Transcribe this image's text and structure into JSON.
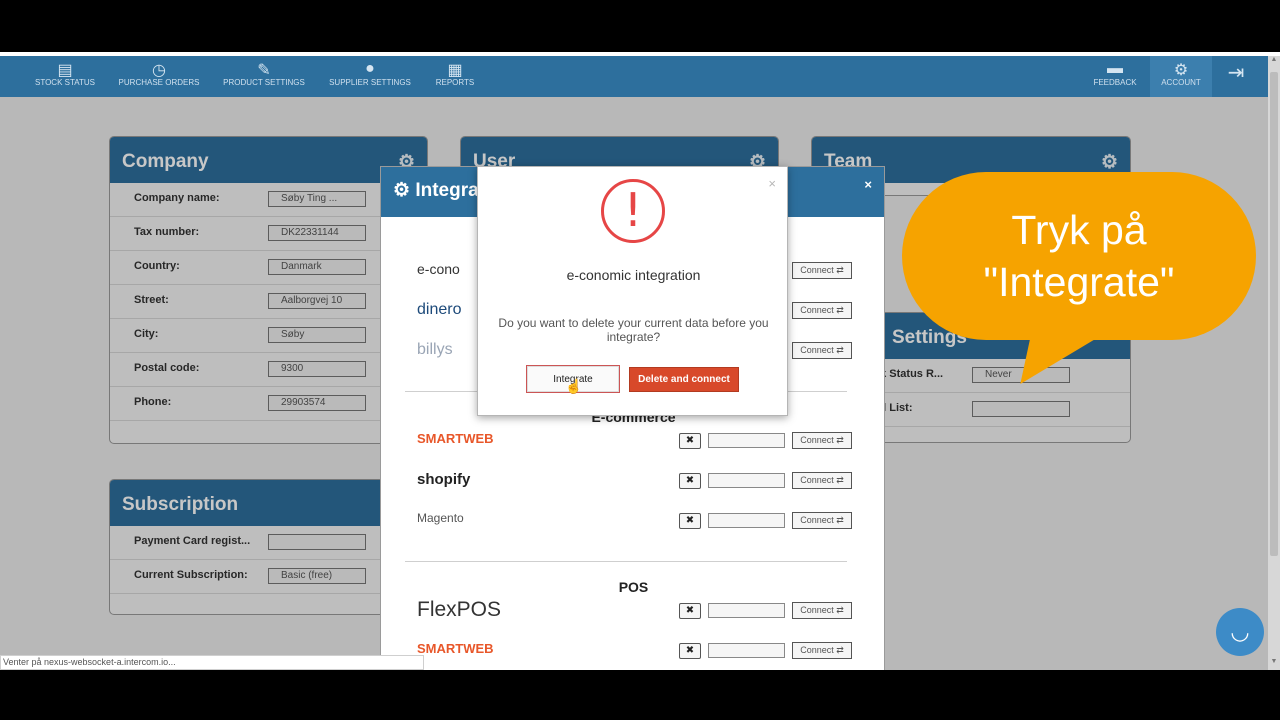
{
  "nav": {
    "items": [
      {
        "label": "STOCK STATUS",
        "icon": "list-icon"
      },
      {
        "label": "PURCHASE ORDERS",
        "icon": "clock-icon"
      },
      {
        "label": "PRODUCT SETTINGS",
        "icon": "pencil-icon"
      },
      {
        "label": "SUPPLIER SETTINGS",
        "icon": "user-icon"
      },
      {
        "label": "REPORTS",
        "icon": "clipboard-icon"
      }
    ],
    "right_items": [
      {
        "label": "FEEDBACK",
        "icon": "chat-icon"
      },
      {
        "label": "ACCOUNT",
        "icon": "gear-icon"
      },
      {
        "label": "",
        "icon": "logout-icon"
      }
    ]
  },
  "company": {
    "title": "Company",
    "rows": [
      {
        "label": "Company name:",
        "value": "Søby Ting ..."
      },
      {
        "label": "Tax number:",
        "value": "DK22331144"
      },
      {
        "label": "Country:",
        "value": "Danmark"
      },
      {
        "label": "Street:",
        "value": "Aalborgvej 10"
      },
      {
        "label": "City:",
        "value": "Søby"
      },
      {
        "label": "Postal code:",
        "value": "9300"
      },
      {
        "label": "Phone:",
        "value": "29903574"
      }
    ]
  },
  "user": {
    "title": "User"
  },
  "team": {
    "title": "Team"
  },
  "settings": {
    "title": "Settings",
    "rows": [
      {
        "label": "ck Status R...",
        "value": "Never"
      },
      {
        "label": "ail List:",
        "value": ""
      }
    ]
  },
  "subscription": {
    "title": "Subscription",
    "rows": [
      {
        "label": "Payment Card regist...",
        "value": ""
      },
      {
        "label": "Current Subscription:",
        "value": "Basic (free)"
      }
    ]
  },
  "integrations": {
    "title": "Integra",
    "close": "×",
    "accounting": [
      {
        "name": "e-conomic",
        "logo": "e-cono",
        "color": "#333333",
        "connect": "Connect ⇄"
      },
      {
        "name": "dinero",
        "logo": "dinero",
        "color": "#1d4a7a",
        "connect": "Connect ⇄"
      },
      {
        "name": "billys",
        "logo": "billys",
        "color": "#9aa5b5",
        "connect": "Connect ⇄"
      }
    ],
    "ecommerce_title": "E-commerce",
    "ecommerce": [
      {
        "name": "smartweb",
        "logo": "SMARTWEB",
        "color": "#e8572a",
        "connect": "Connect ⇄"
      },
      {
        "name": "shopify",
        "logo": "shopify",
        "color": "#222222",
        "connect": "Connect ⇄"
      },
      {
        "name": "magento",
        "logo": "Magento",
        "color": "#555555",
        "connect": "Connect ⇄"
      }
    ],
    "pos_title": "POS",
    "pos": [
      {
        "name": "flexpos",
        "logo": "FlexPOS",
        "color": "#333333",
        "connect": "Connect ⇄"
      },
      {
        "name": "smartweb-pos",
        "logo": "SMARTWEB",
        "color": "#e8572a",
        "connect": "Connect ⇄"
      }
    ],
    "remove_symbol": "✖"
  },
  "dialog": {
    "close": "×",
    "alert_symbol": "!",
    "title": "e-conomic integration",
    "message": "Do you want to delete your current data before you integrate?",
    "integrate_label": "Integrate",
    "delete_connect_label": "Delete and connect"
  },
  "callout": {
    "line1": "Tryk på",
    "line2": "\"Integrate\"",
    "color": "#f6a300"
  },
  "status_bar": {
    "text": "Venter på nexus-websocket-a.intercom.io..."
  },
  "colors": {
    "nav_blue": "#2d6f9d",
    "danger_red": "#d8492a",
    "chat_blue": "#3d8bc7"
  }
}
